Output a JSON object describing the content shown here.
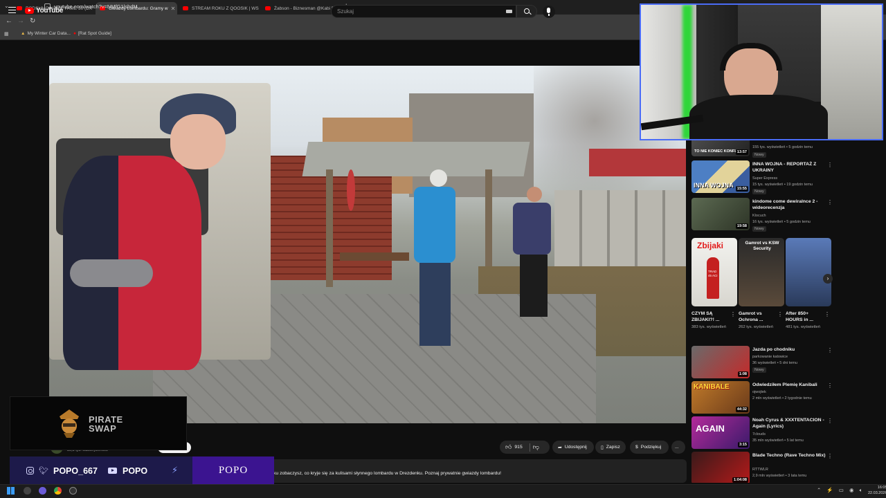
{
  "browser": {
    "tabs": [
      {
        "label": "PODSUMOWANIE FAME 30 (DX",
        "active": false
      },
      {
        "label": "Gwiazdy Lombardu: Gramy w",
        "active": true
      },
      {
        "label": "STREAM ROKU Z QOOSIK | WS",
        "active": false
      },
      {
        "label": "Żabson - Biznesman @Kabi Pro",
        "active": false
      }
    ],
    "new_tab": "+",
    "url": "youtube.com/watch?v=NMfG1lsbdM",
    "bookmarks": [
      "My Winter Car Data...",
      "[Rat Spot Guide]"
    ]
  },
  "youtube": {
    "logo_text": "YouTube",
    "logo_country": "MT",
    "search_placeholder": "Szukaj"
  },
  "video": {
    "subscribers": "39,5 tys. subskrybentów",
    "likes": "915",
    "share_label": "Udostępnij",
    "save_label": "Zapisz",
    "thanks_label": "Podziękuj",
    "more": "...",
    "description": "ku zobaczysz, co kryje się za kulisami słynnego lombardu w Drezdenku. Poznaj prywatnie gwiazdy lombardu!"
  },
  "recommendations": [
    {
      "title": "",
      "channel": "",
      "meta": "155 tys. wyświetleń • 5 godzin temu",
      "badge": "Nowy",
      "duration": "13:57",
      "thumb_text": "TO NIE KONIEC KONFL..."
    },
    {
      "title": "INNA WOJNA - REPORTAŻ Z UKRAINY",
      "channel": "Super Express",
      "meta": "15 tys. wyświetleń • 19 godzin temu",
      "badge": "Nowy",
      "duration": "15:55",
      "thumb_text": "INNA WOJNA"
    },
    {
      "title": "kindome come dewiralnce 2 - wideorecenzja",
      "channel": "Klocuch",
      "meta": "16 tys. wyświetleń • 5 godzin temu",
      "badge": "Nowy",
      "duration": "19:58",
      "thumb_text": ""
    },
    {
      "title": "Jazda po chodniku",
      "channel": "parkowanie katowice",
      "meta": "36 wyświetleń • 5 dni temu",
      "badge": "Nowy",
      "duration": "1:08",
      "thumb_text": ""
    },
    {
      "title": "Odwiedziłem Plemię Kanibali",
      "channel": "ojwojtek",
      "meta": "2 mln wyświetleń • 2 tygodnie temu",
      "badge": "",
      "duration": "44:32",
      "thumb_text": "KANIBALE"
    },
    {
      "title": "Noah Cyrus & XXXTENTACION - Again (Lyrics)",
      "channel": "7clouds",
      "meta": "35 mln wyświetleń • 5 lat temu",
      "badge": "",
      "duration": "3:15",
      "thumb_text": "AGAIN"
    },
    {
      "title": "Blade Techno (Rave Techno Mix)",
      "channel": "RTTWLR",
      "meta": "2,9 mln wyświetleń • 3 lata temu",
      "badge": "",
      "duration": "1:04:08",
      "thumb_text": ""
    }
  ],
  "shorts": [
    {
      "title": "CZYM SĄ ZBIJAKI?! ...",
      "views": "383 tys. wyświetleń",
      "thumb_text": "Zbijaki",
      "thumb_sub": "TRAD 45 ACI"
    },
    {
      "title": "Gamrot vs Ochrona ...",
      "views": "262 tys. wyświetleń",
      "thumb_text": "Gamrot vs KSW Security",
      "thumb_sub": ""
    },
    {
      "title": "After 850+ HOURS in ...",
      "views": "481 tys. wyświetleń",
      "thumb_text": "",
      "thumb_sub": ""
    }
  ],
  "overlay": {
    "sponsor_line1": "PIRATE",
    "sponsor_line2": "SWAP",
    "handle": "POPO_667",
    "yt_name": "POPO",
    "brand": "POPO"
  },
  "taskbar": {
    "time": "16:05",
    "date": "22.03.2026"
  },
  "colors": {
    "webcam_border": "#4a6cf7",
    "social_bar": "#1d1a4a",
    "brand_box": "#3b1490",
    "youtube_red": "#ff0000"
  }
}
